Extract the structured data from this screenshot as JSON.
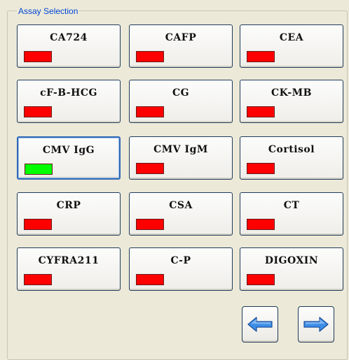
{
  "group": {
    "title": "Assay Selection"
  },
  "assays": [
    {
      "label": "CA724",
      "status_color": "#ff0000"
    },
    {
      "label": "CAFP",
      "status_color": "#ff0000"
    },
    {
      "label": "CEA",
      "status_color": "#ff0000"
    },
    {
      "label": "cF-B-HCG",
      "status_color": "#ff0000"
    },
    {
      "label": "CG",
      "status_color": "#ff0000"
    },
    {
      "label": "CK-MB",
      "status_color": "#ff0000"
    },
    {
      "label": "CMV IgG",
      "status_color": "#00ff00",
      "selected": true
    },
    {
      "label": "CMV IgM",
      "status_color": "#ff0000"
    },
    {
      "label": "Cortisol",
      "status_color": "#ff0000"
    },
    {
      "label": "CRP",
      "status_color": "#ff0000"
    },
    {
      "label": "CSA",
      "status_color": "#ff0000"
    },
    {
      "label": "CT",
      "status_color": "#ff0000"
    },
    {
      "label": "CYFRA211",
      "status_color": "#ff0000"
    },
    {
      "label": "C-P",
      "status_color": "#ff0000"
    },
    {
      "label": "DIGOXIN",
      "status_color": "#ff0000"
    }
  ],
  "navigation": {
    "previous_icon": "arrow-left-icon",
    "next_icon": "arrow-right-icon",
    "arrow_color": "#3c8ee8"
  }
}
